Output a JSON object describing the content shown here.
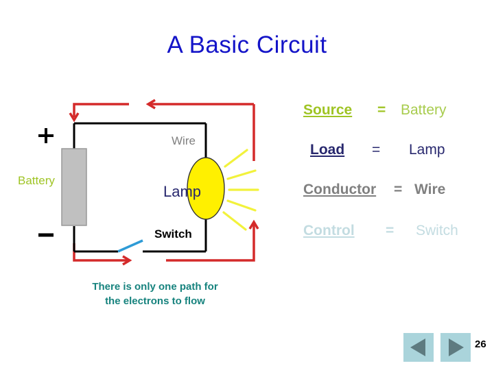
{
  "slide": {
    "title": "A Basic Circuit",
    "caption_line1": "There is only one path for",
    "caption_line2": "the electrons to flow",
    "page_number": "26",
    "title_color": "#1414C8",
    "caption_color": "#17837E",
    "background": "#ffffff"
  },
  "diagram": {
    "labels": {
      "battery": "Battery",
      "wire": "Wire",
      "lamp": "Lamp",
      "switch": "Switch",
      "plus": "+",
      "minus": "-"
    },
    "colors": {
      "battery_label": "#9FC424",
      "wire_label": "#808080",
      "lamp_label": "#28286E",
      "switch_label": "#000000",
      "wire_line": "#000000",
      "battery_body": "#C0C0C0",
      "battery_body_border": "#999999",
      "bulb_fill": "#FFF000",
      "bulb_border": "#333333",
      "bulb_rays": "#F2F23C",
      "switch_blade": "#2E9BD6",
      "current_arrow": "#D42A2A"
    }
  },
  "definitions": {
    "rows": [
      {
        "term": "Source",
        "eq": "=",
        "value": "Battery",
        "color": "#9FC424"
      },
      {
        "term": "Load",
        "eq": "=",
        "value": "Lamp",
        "color": "#28286E"
      },
      {
        "term": "Conductor",
        "eq": "=",
        "value": "Wire",
        "color": "#808080"
      },
      {
        "term": "Control",
        "eq": "=",
        "value": "Switch",
        "color": "#C3DCE1"
      }
    ]
  },
  "nav": {
    "prev_label": "previous-slide",
    "next_label": "next-slide",
    "button_bg": "#AAD4DB",
    "arrow_color": "#5E7B80"
  }
}
